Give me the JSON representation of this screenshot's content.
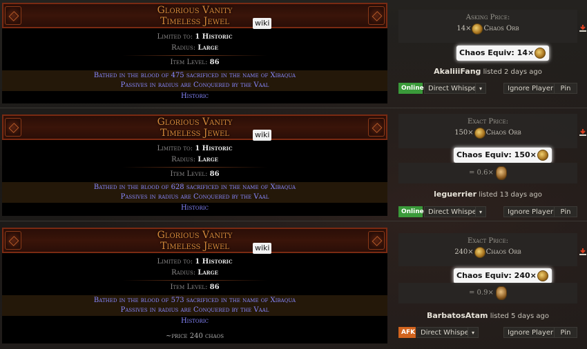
{
  "wiki_label": "wiki",
  "equiv_label": "Chaos Equiv:",
  "whisper_label": "Direct Whisper",
  "ignore_label": "Ignore Player",
  "pin_label": "Pin",
  "listings": [
    {
      "name": "Glorious Vanity",
      "base": "Timeless Jewel",
      "limited_label": "Limited to:",
      "limited_value": "1 Historic",
      "radius_label": "Radius:",
      "radius_value": "Large",
      "ilvl_label": "Item Level:",
      "ilvl_value": "86",
      "mod1": "Bathed in the blood of 475 sacrificed in the name of Xibaqua",
      "mod2": "Passives in radius are Conquered by the Vaal",
      "tag": "Historic",
      "price_label": "Asking Price:",
      "price_amount": "14×",
      "currency": "Chaos Orb",
      "equiv_amount": "14×",
      "seller": "AkaliiiFang",
      "listed": "listed 2 days ago",
      "status": "Online"
    },
    {
      "name": "Glorious Vanity",
      "base": "Timeless Jewel",
      "limited_label": "Limited to:",
      "limited_value": "1 Historic",
      "radius_label": "Radius:",
      "radius_value": "Large",
      "ilvl_label": "Item Level:",
      "ilvl_value": "86",
      "mod1": "Bathed in the blood of 628 sacrificed in the name of Xibaqua",
      "mod2": "Passives in radius are Conquered by the Vaal",
      "tag": "Historic",
      "price_label": "Exact Price:",
      "price_amount": "150×",
      "currency": "Chaos Orb",
      "equiv_amount": "150×",
      "ratio": "= 0.6×",
      "seller": "leguerrier",
      "listed": "listed 13 days ago",
      "status": "Online"
    },
    {
      "name": "Glorious Vanity",
      "base": "Timeless Jewel",
      "limited_label": "Limited to:",
      "limited_value": "1 Historic",
      "radius_label": "Radius:",
      "radius_value": "Large",
      "ilvl_label": "Item Level:",
      "ilvl_value": "86",
      "mod1": "Bathed in the blood of 573 sacrificed in the name of Xibaqua",
      "mod2": "Passives in radius are Conquered by the Vaal",
      "tag": "Historic",
      "note": "~price 240 chaos",
      "price_label": "Exact Price:",
      "price_amount": "240×",
      "currency": "Chaos Orb",
      "equiv_amount": "240×",
      "ratio": "= 0.9×",
      "seller": "BarbatosAtam",
      "listed": "listed 5 days ago",
      "status": "AFK"
    }
  ],
  "colors": {
    "unique_name": "#d4893a",
    "magic_mod": "#8888ff",
    "online": "#3a9a3a",
    "afk": "#d2641e"
  }
}
